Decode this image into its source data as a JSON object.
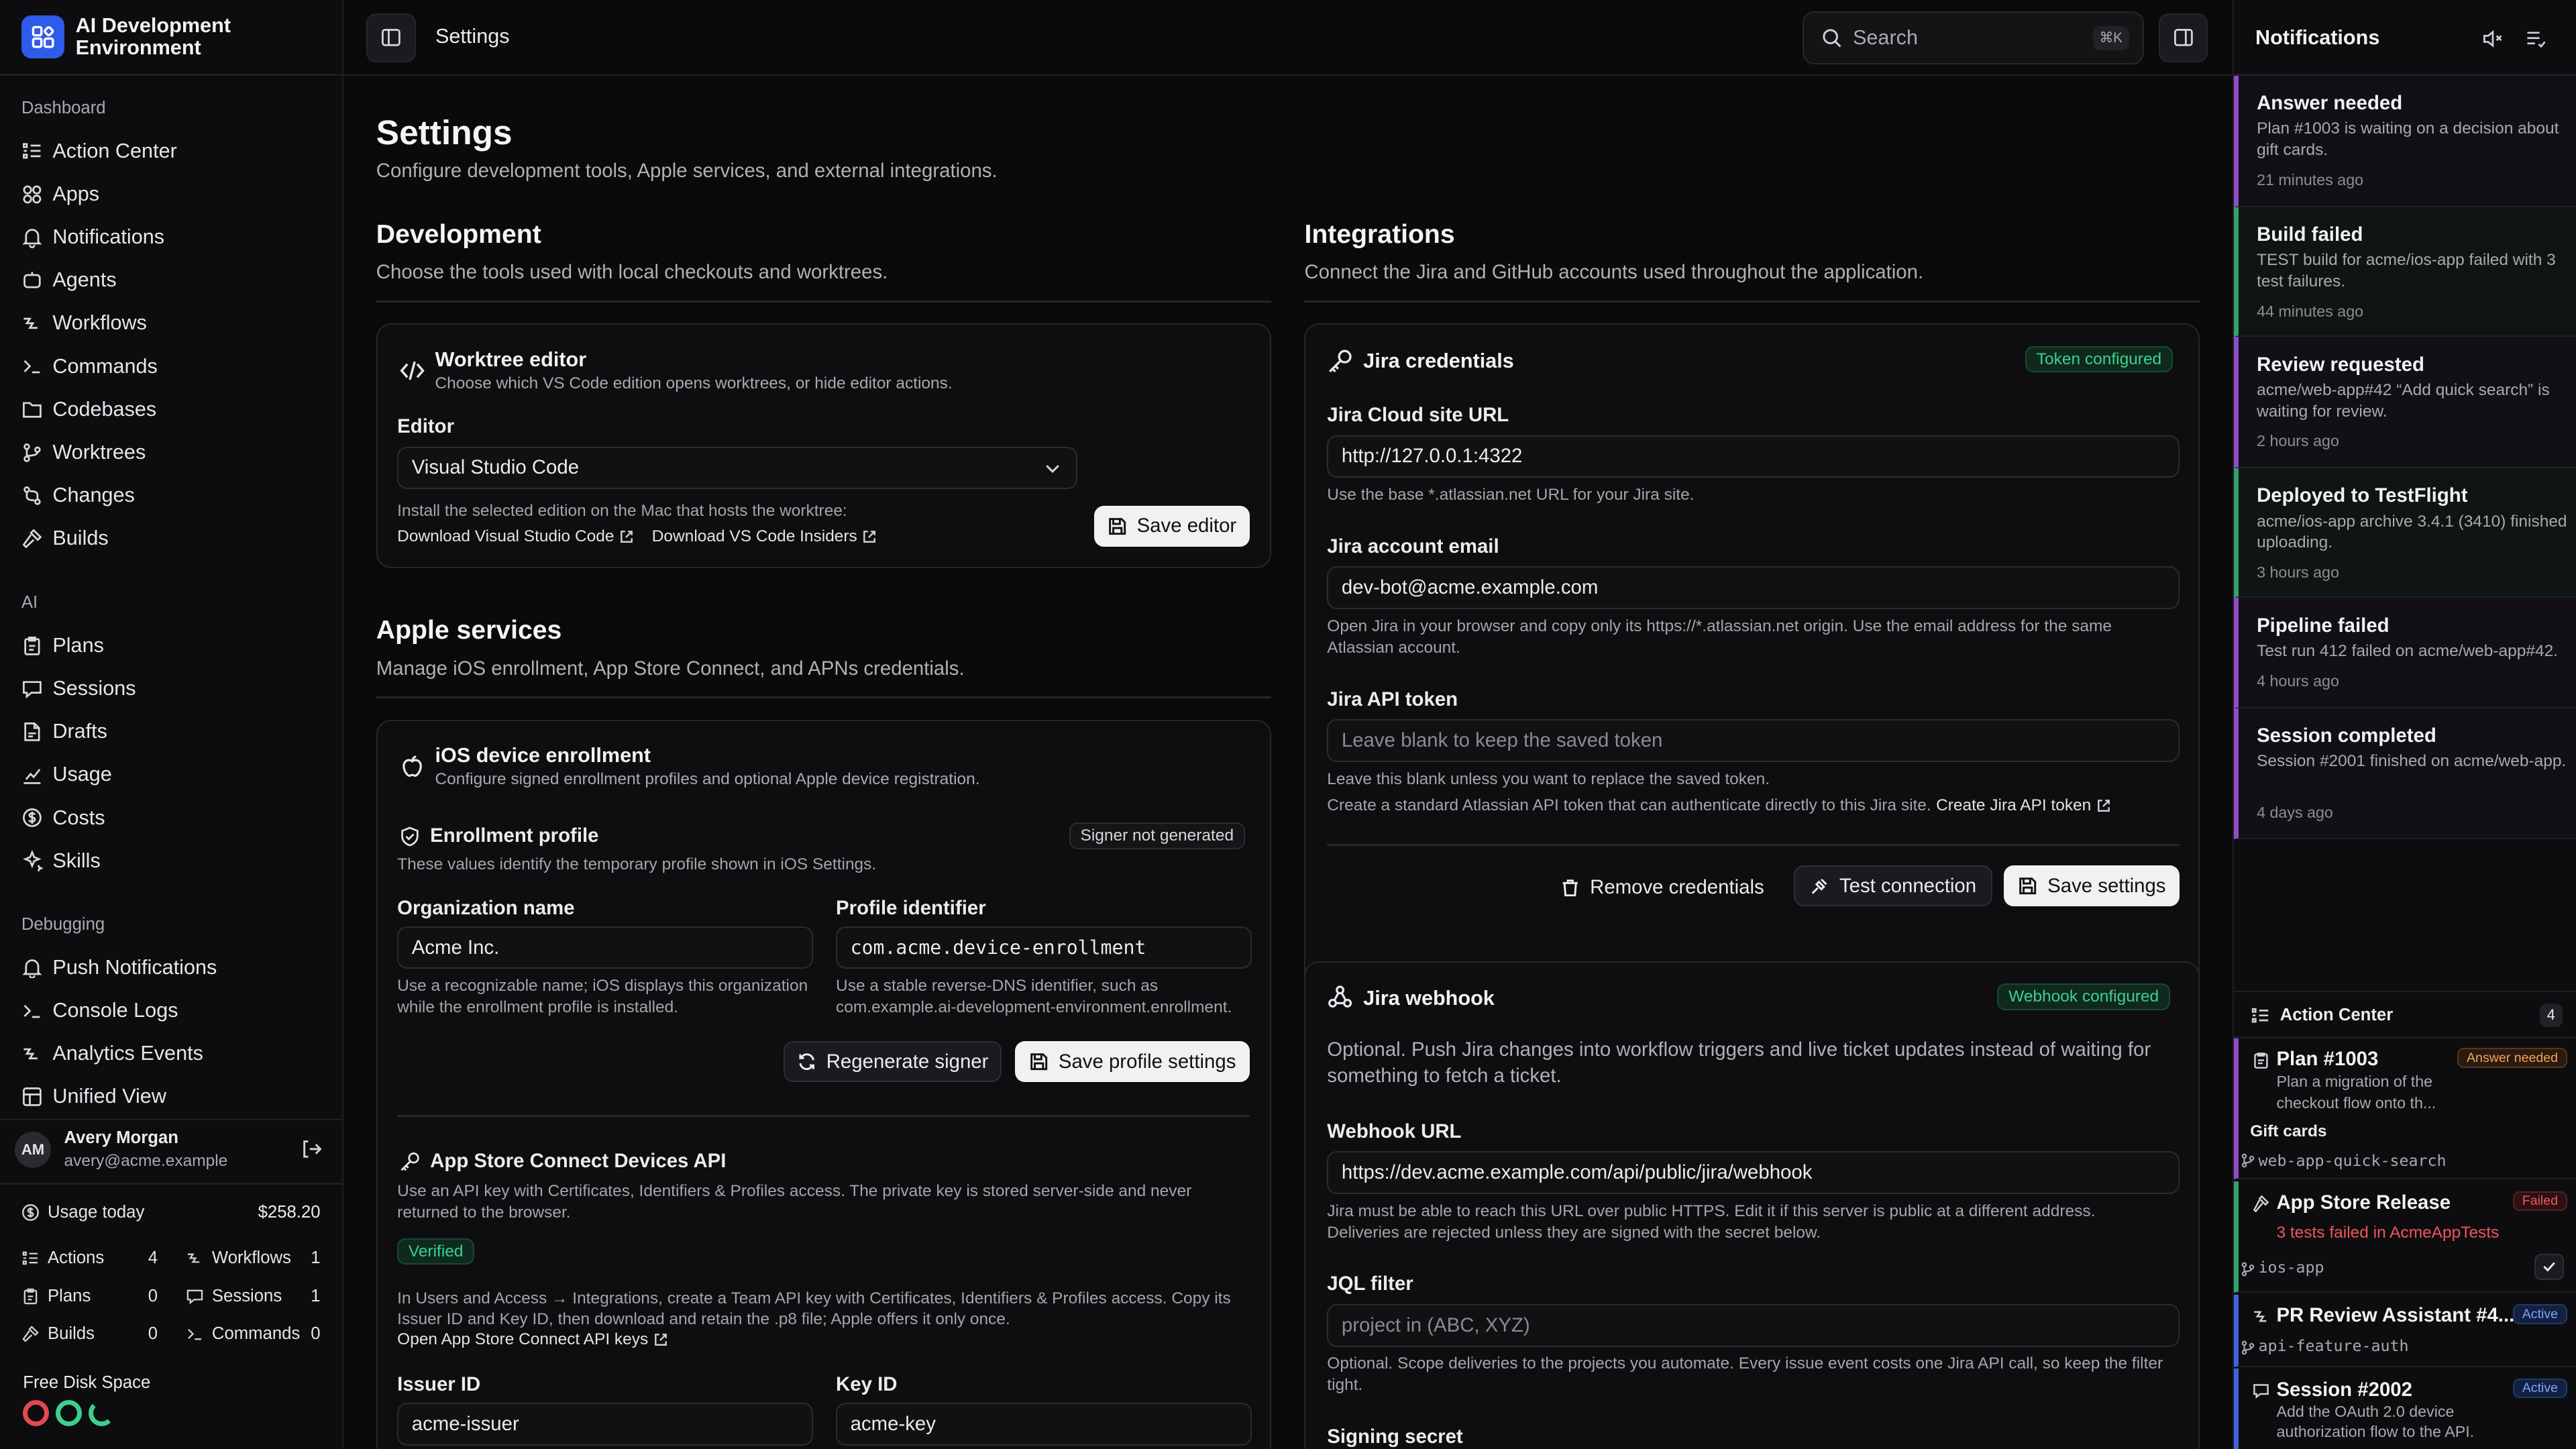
{
  "app": {
    "title": "AI Development Environment"
  },
  "sidebar": {
    "dashboard_label": "Dashboard",
    "dashboard_items": [
      {
        "label": "Action Center",
        "icon": "list-check-icon"
      },
      {
        "label": "Apps",
        "icon": "apps-icon"
      },
      {
        "label": "Notifications",
        "icon": "bell-icon"
      },
      {
        "label": "Agents",
        "icon": "agent-icon"
      },
      {
        "label": "Workflows",
        "icon": "workflow-icon"
      },
      {
        "label": "Commands",
        "icon": "terminal-icon"
      },
      {
        "label": "Codebases",
        "icon": "folder-icon"
      },
      {
        "label": "Worktrees",
        "icon": "branch-icon"
      },
      {
        "label": "Changes",
        "icon": "diff-icon"
      },
      {
        "label": "Builds",
        "icon": "hammer-icon"
      }
    ],
    "ai_label": "AI",
    "ai_items": [
      {
        "label": "Plans",
        "icon": "clipboard-icon"
      },
      {
        "label": "Sessions",
        "icon": "chat-icon"
      },
      {
        "label": "Drafts",
        "icon": "draft-icon"
      },
      {
        "label": "Usage",
        "icon": "chart-icon"
      },
      {
        "label": "Costs",
        "icon": "dollar-icon"
      },
      {
        "label": "Skills",
        "icon": "sparkle-icon"
      }
    ],
    "debug_label": "Debugging",
    "debug_items": [
      {
        "label": "Push Notifications",
        "icon": "push-icon"
      },
      {
        "label": "Console Logs",
        "icon": "terminal-icon"
      },
      {
        "label": "Analytics Events",
        "icon": "analytics-icon"
      },
      {
        "label": "Unified View",
        "icon": "unified-icon"
      }
    ],
    "user": {
      "initials": "AM",
      "name": "Avery Morgan",
      "email": "avery@acme.example"
    },
    "usage": {
      "label": "Usage today",
      "value": "$258.20"
    },
    "stats": [
      {
        "label": "Actions",
        "value": "4"
      },
      {
        "label": "Workflows",
        "value": "1"
      },
      {
        "label": "Plans",
        "value": "0"
      },
      {
        "label": "Sessions",
        "value": "1"
      },
      {
        "label": "Builds",
        "value": "0"
      },
      {
        "label": "Commands",
        "value": "0"
      }
    ],
    "disk": {
      "label": "Free Disk Space",
      "colors": [
        "#e5484d",
        "#3ecf8e",
        "#3ecf8e"
      ]
    }
  },
  "header": {
    "title": "Settings",
    "search_placeholder": "Search",
    "shortcut": "⌘K"
  },
  "page": {
    "title": "Settings",
    "subtitle": "Configure development tools, Apple services, and external integrations."
  },
  "development": {
    "title": "Development",
    "subtitle": "Choose the tools used with local checkouts and worktrees.",
    "editor_card": {
      "title": "Worktree editor",
      "desc": "Choose which VS Code edition opens worktrees, or hide editor actions.",
      "field_label": "Editor",
      "value": "Visual Studio Code",
      "help": "Install the selected edition on the Mac that hosts the worktree:",
      "link1": "Download Visual Studio Code",
      "link2": "Download VS Code Insiders",
      "save": "Save editor"
    }
  },
  "apple": {
    "title": "Apple services",
    "subtitle": "Manage iOS enrollment, App Store Connect, and APNs credentials.",
    "enroll_card": {
      "title": "iOS device enrollment",
      "desc": "Configure signed enrollment profiles and optional Apple device registration.",
      "profile_title": "Enrollment profile",
      "profile_badge": "Signer not generated",
      "profile_desc": "These values identify the temporary profile shown in iOS Settings.",
      "org_label": "Organization name",
      "org_value": "Acme Inc.",
      "org_help": "Use a recognizable name; iOS displays this organization while the enrollment profile is installed.",
      "pid_label": "Profile identifier",
      "pid_value": "com.acme.device-enrollment",
      "pid_help": "Use a stable reverse-DNS identifier, such as com.example.ai-development-environment.enrollment.",
      "regen": "Regenerate signer",
      "save": "Save profile settings",
      "asc_title": "App Store Connect Devices API",
      "asc_desc": "Use an API key with Certificates, Identifiers & Profiles access. The private key is stored server-side and never returned to the browser.",
      "verified": "Verified",
      "asc_help": "In Users and Access → Integrations, create a Team API key with Certificates, Identifiers & Profiles access. Copy its Issuer ID and Key ID, then download and retain the .p8 file; Apple offers it only once.",
      "asc_link": "Open App Store Connect API keys",
      "issuer_label": "Issuer ID",
      "issuer_value": "acme-issuer",
      "key_label": "Key ID",
      "key_value": "acme-key"
    }
  },
  "integrations": {
    "title": "Integrations",
    "subtitle": "Connect the Jira and GitHub accounts used throughout the application.",
    "jira": {
      "title": "Jira credentials",
      "badge": "Token configured",
      "url_label": "Jira Cloud site URL",
      "url_value": "http://127.0.0.1:4322",
      "url_help": "Use the base *.atlassian.net URL for your Jira site.",
      "email_label": "Jira account email",
      "email_value": "dev-bot@acme.example.com",
      "email_help": "Open Jira in your browser and copy only its https://*.atlassian.net origin. Use the email address for the same Atlassian account.",
      "token_label": "Jira API token",
      "token_placeholder": "Leave blank to keep the saved token",
      "token_help1": "Leave this blank unless you want to replace the saved token.",
      "token_help2": "Create a standard Atlassian API token that can authenticate directly to this Jira site.",
      "token_link": "Create Jira API token",
      "remove": "Remove credentials",
      "test": "Test connection",
      "save": "Save settings"
    },
    "webhook": {
      "title": "Jira webhook",
      "badge": "Webhook configured",
      "desc": "Optional. Push Jira changes into workflow triggers and live ticket updates instead of waiting for something to fetch a ticket.",
      "url_label": "Webhook URL",
      "url_value": "https://dev.acme.example.com/api/public/jira/webhook",
      "url_help": "Jira must be able to reach this URL over public HTTPS. Edit it if this server is public at a different address. Deliveries are rejected unless they are signed with the secret below.",
      "jql_label": "JQL filter",
      "jql_placeholder": "project in (ABC, XYZ)",
      "jql_help": "Optional. Scope deliveries to the projects you automate. Every issue event costs one Jira API call, so keep the filter tight.",
      "secret_label": "Signing secret"
    }
  },
  "notifications": {
    "title": "Notifications",
    "items": [
      {
        "title": "Answer needed",
        "body": "Plan #1003 is waiting on a decision about gift cards.",
        "time": "21 minutes ago",
        "color": "#8e4ec6"
      },
      {
        "title": "Build failed",
        "body": "TEST build for acme/ios-app failed with 3 test failures.",
        "time": "44 minutes ago",
        "color": "#30a46c"
      },
      {
        "title": "Review requested",
        "body": "acme/web-app#42 “Add quick search” is waiting for review.",
        "time": "2 hours ago",
        "color": "#8e4ec6"
      },
      {
        "title": "Deployed to TestFlight",
        "body": "acme/ios-app archive 3.4.1 (3410) finished uploading.",
        "time": "3 hours ago",
        "color": "#30a46c"
      },
      {
        "title": "Pipeline failed",
        "body": "Test run 412 failed on acme/web-app#42.",
        "time": "4 hours ago",
        "color": "#8e4ec6"
      },
      {
        "title": "Session completed",
        "body": "Session #2001 finished on acme/web-app.",
        "time": "4 days ago",
        "color": "#8e4ec6"
      }
    ]
  },
  "action_center": {
    "title": "Action Center",
    "count": "4",
    "items": [
      {
        "title": "Plan #1003",
        "badge": "Answer needed",
        "line1": "Plan a migration of the",
        "line2": "checkout flow onto th...",
        "tag": "Gift cards",
        "branch": "web-app-quick-search",
        "color": "#8e4ec6"
      },
      {
        "title": "App Store Release",
        "badge": "Failed",
        "line1": "3 tests failed in AcmeAppTests",
        "branch": "ios-app",
        "color": "#30a46c"
      },
      {
        "title": "PR Review Assistant #4...",
        "badge": "Active",
        "branch": "api-feature-auth",
        "color": "#3e63dd"
      },
      {
        "title": "Session #2002",
        "badge": "Active",
        "line1": "Add the OAuth 2.0 device",
        "line2": "authorization flow to the API.",
        "color": "#3e63dd"
      }
    ]
  }
}
